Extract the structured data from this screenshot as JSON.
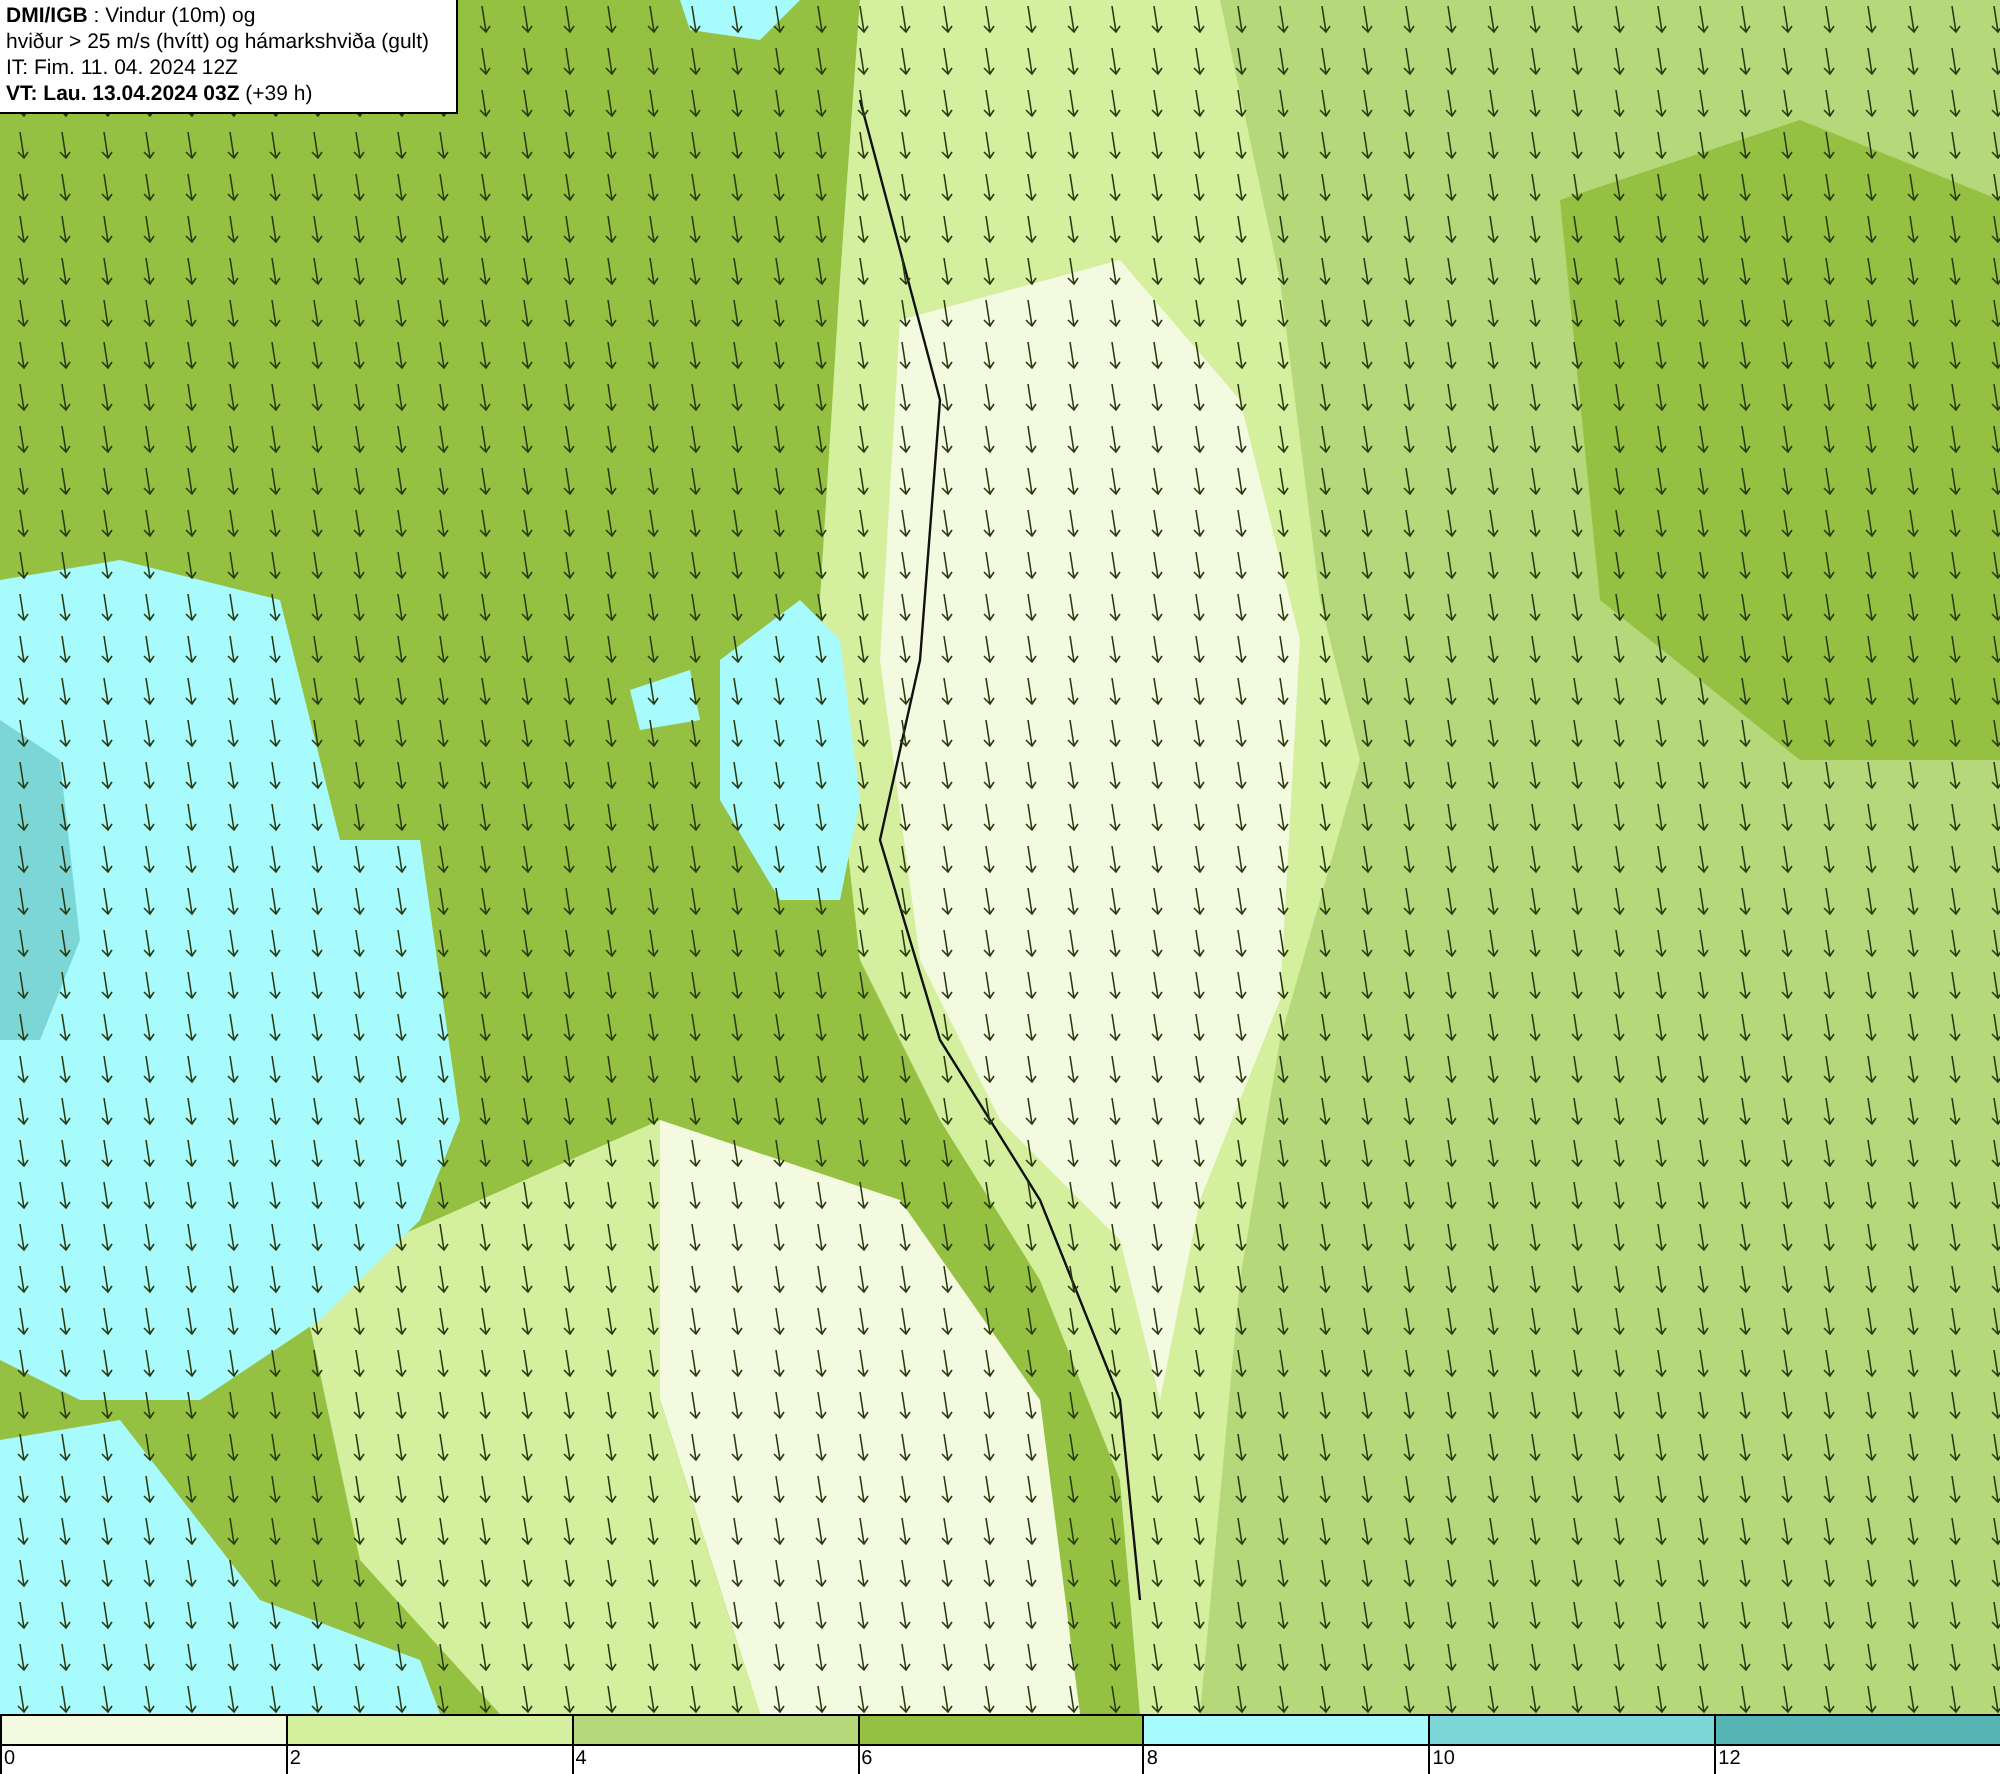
{
  "header": {
    "lines": [
      "**DMI/IGB** : Vindur (10m) og",
      "hviður > 25 m/s (hvítt) og hámarkshviða (gult)",
      "IT: Fim. 11. 04. 2024 12Z",
      "**VT: Lau. 13.04.2024 03Z** (+39 h)"
    ]
  },
  "legend": {
    "segments": [
      {
        "label": "0",
        "color": "#f3fadf"
      },
      {
        "label": "2",
        "color": "#d4ef9e"
      },
      {
        "label": "4",
        "color": "#b5d97a"
      },
      {
        "label": "6",
        "color": "#95c143"
      },
      {
        "label": "8",
        "color": "#a8fbfd"
      },
      {
        "label": "10",
        "color": "#7dd6d6"
      },
      {
        "label": "12",
        "color": "#55b5b5"
      }
    ]
  }
}
